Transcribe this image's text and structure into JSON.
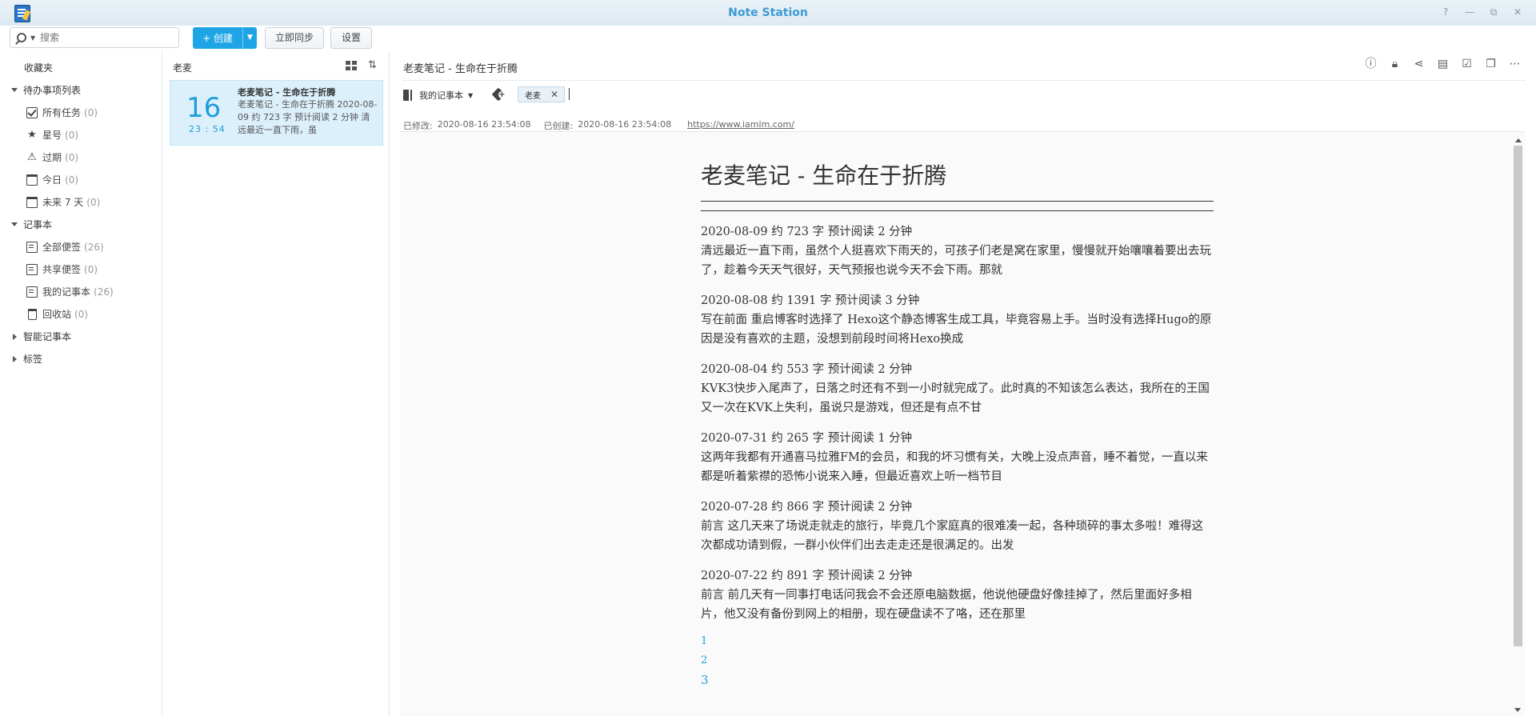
{
  "window": {
    "title": "Note Station",
    "controls": [
      "?",
      "—",
      "⧉",
      "✕"
    ]
  },
  "toolbar": {
    "search_placeholder": "搜索",
    "create_label": "+ 创建",
    "sync_label": "立即同步",
    "settings_label": "设置"
  },
  "sidebar": {
    "header": "收藏夹",
    "todo_group": "待办事项列表",
    "todo_items": [
      {
        "label": "所有任务",
        "count": "(0)"
      },
      {
        "label": "星号",
        "count": "(0)"
      },
      {
        "label": "过期",
        "count": "(0)"
      },
      {
        "label": "今日",
        "count": "(0)"
      },
      {
        "label": "未来 7 天",
        "count": "(0)"
      }
    ],
    "notebook_group": "记事本",
    "notebook_items": [
      {
        "label": "全部便签",
        "count": "(26)"
      },
      {
        "label": "共享便签",
        "count": "(0)"
      },
      {
        "label": "我的记事本",
        "count": "(26)"
      },
      {
        "label": "回收站",
        "count": "(0)"
      }
    ],
    "smart_group": "智能记事本",
    "tags_group": "标签"
  },
  "notelist": {
    "title": "老麦",
    "card": {
      "day": "16",
      "time": "23 : 54",
      "title": "老麦笔记 - 生命在于折腾",
      "snippet": "老麦笔记 - 生命在于折腾 2020-08-09 约 723 字 预计阅读 2 分钟 清远最近一直下雨，虽"
    }
  },
  "editor": {
    "title": "老麦笔记 - 生命在于折腾",
    "notebook": "我的记事本",
    "tag": "老麦",
    "modified_label": "已修改:",
    "modified_value": "2020-08-16 23:54:08",
    "created_label": "已创建:",
    "created_value": "2020-08-16 23:54:08",
    "source_url": "https://www.iamlm.com/",
    "icons": [
      "info-icon",
      "lock-icon",
      "share-icon",
      "presentation-icon",
      "task-icon",
      "gallery-icon",
      "more-icon"
    ]
  },
  "document": {
    "heading": "老麦笔记 - 生命在于折腾",
    "entries": [
      {
        "meta": "2020-08-09 约 723 字 预计阅读 2 分钟",
        "text": "清远最近一直下雨，虽然个人挺喜欢下雨天的，可孩子们老是窝在家里，慢慢就开始嚷嚷着要出去玩了，趁着今天天气很好，天气预报也说今天不会下雨。那就"
      },
      {
        "meta": "2020-08-08 约 1391 字 预计阅读 3 分钟",
        "text": "写在前面 重启博客时选择了 Hexo这个静态博客生成工具，毕竟容易上手。当时没有选择Hugo的原因是没有喜欢的主题，没想到前段时间将Hexo换成"
      },
      {
        "meta": "2020-08-04 约 553 字 预计阅读 2 分钟",
        "text": "KVK3快步入尾声了，日落之时还有不到一小时就完成了。此时真的不知该怎么表达，我所在的王国又一次在KVK上失利，虽说只是游戏，但还是有点不甘"
      },
      {
        "meta": "2020-07-31 约 265 字 预计阅读 1 分钟",
        "text": "这两年我都有开通喜马拉雅FM的会员，和我的坏习惯有关，大晚上没点声音，睡不着觉，一直以来都是听着紫襟的恐怖小说来入睡，但最近喜欢上听一档节目"
      },
      {
        "meta": "2020-07-28 约 866 字 预计阅读 2 分钟",
        "text": "前言 这几天来了场说走就走的旅行，毕竟几个家庭真的很难凑一起，各种琐碎的事太多啦！难得这次都成功请到假，一群小伙伴们出去走走还是很满足的。出发"
      },
      {
        "meta": "2020-07-22 约 891 字 预计阅读 2 分钟",
        "text": "前言 前几天有一同事打电话问我会不会还原电脑数据，他说他硬盘好像挂掉了，然后里面好多相片，他又没有备份到网上的相册，现在硬盘读不了咯，还在那里"
      }
    ],
    "pages": [
      "1",
      "2",
      "3"
    ]
  }
}
